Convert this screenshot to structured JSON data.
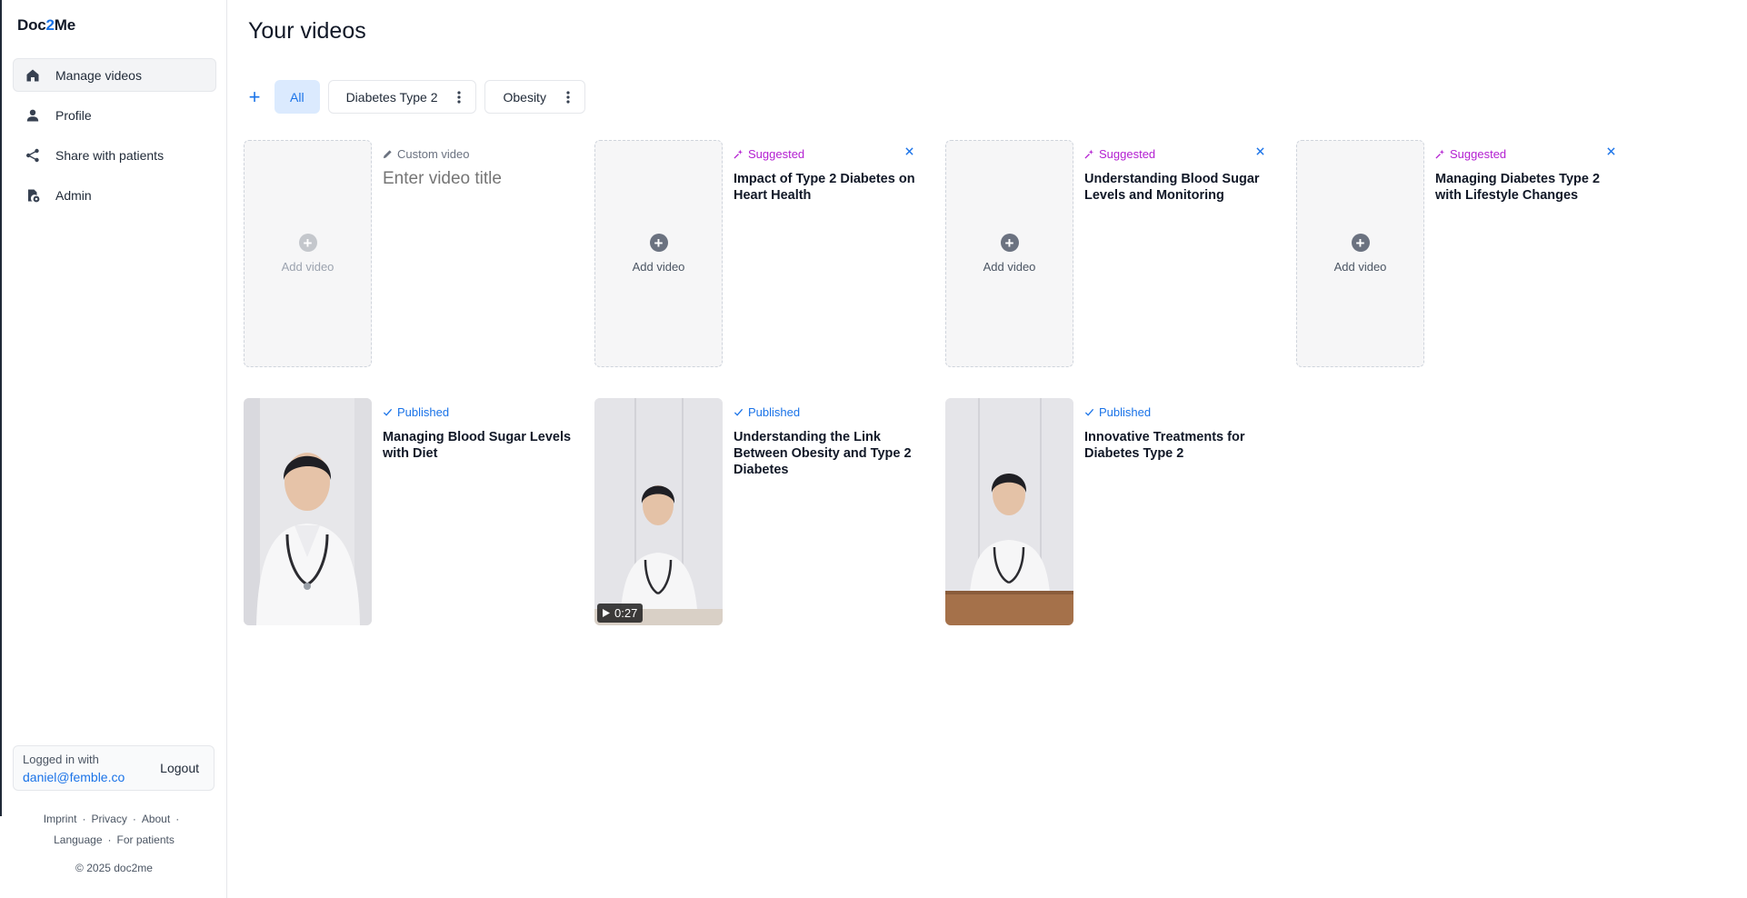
{
  "app": {
    "logo_part1": "Doc",
    "logo_part2": "2",
    "logo_part3": "Me"
  },
  "sidebar": {
    "items": [
      {
        "label": "Manage videos",
        "icon": "home-icon",
        "active": true
      },
      {
        "label": "Profile",
        "icon": "person-icon"
      },
      {
        "label": "Share with patients",
        "icon": "share-icon"
      },
      {
        "label": "Admin",
        "icon": "admin-icon"
      }
    ],
    "login": {
      "caption": "Logged in with",
      "email": "daniel@femble.co",
      "logout_label": "Logout"
    },
    "footer": {
      "links": [
        "Imprint",
        "Privacy",
        "About",
        "Language",
        "For patients"
      ],
      "copyright": "© 2025 doc2me"
    }
  },
  "main": {
    "title": "Your videos",
    "tabs": {
      "add": "+",
      "all": "All",
      "diabetes": "Diabetes Type 2",
      "obesity": "Obesity"
    },
    "cards": [
      {
        "status": "Custom video",
        "type": "custom",
        "add_label": "Add video",
        "title_placeholder": "Enter video title"
      },
      {
        "status": "Suggested",
        "type": "suggested",
        "add_label": "Add video",
        "title": "Impact of Type 2 Diabetes on Heart Health"
      },
      {
        "status": "Suggested",
        "type": "suggested",
        "add_label": "Add video",
        "title": "Understanding Blood Sugar Levels and Monitoring"
      },
      {
        "status": "Suggested",
        "type": "suggested",
        "add_label": "Add video",
        "title": "Managing Diabetes Type 2 with Lifestyle Changes"
      },
      {
        "status": "Published",
        "type": "published",
        "title": "Managing Blood Sugar Levels with Diet"
      },
      {
        "status": "Published",
        "type": "published",
        "title": "Understanding the Link Between Obesity and Type 2 Diabetes",
        "duration": "0:27"
      },
      {
        "status": "Published",
        "type": "published",
        "title": "Innovative Treatments for Diabetes Type 2"
      }
    ]
  },
  "colors": {
    "accent": "#1a73e8",
    "suggested": "#b31fd1",
    "tab_active_bg": "#dbeafe"
  }
}
